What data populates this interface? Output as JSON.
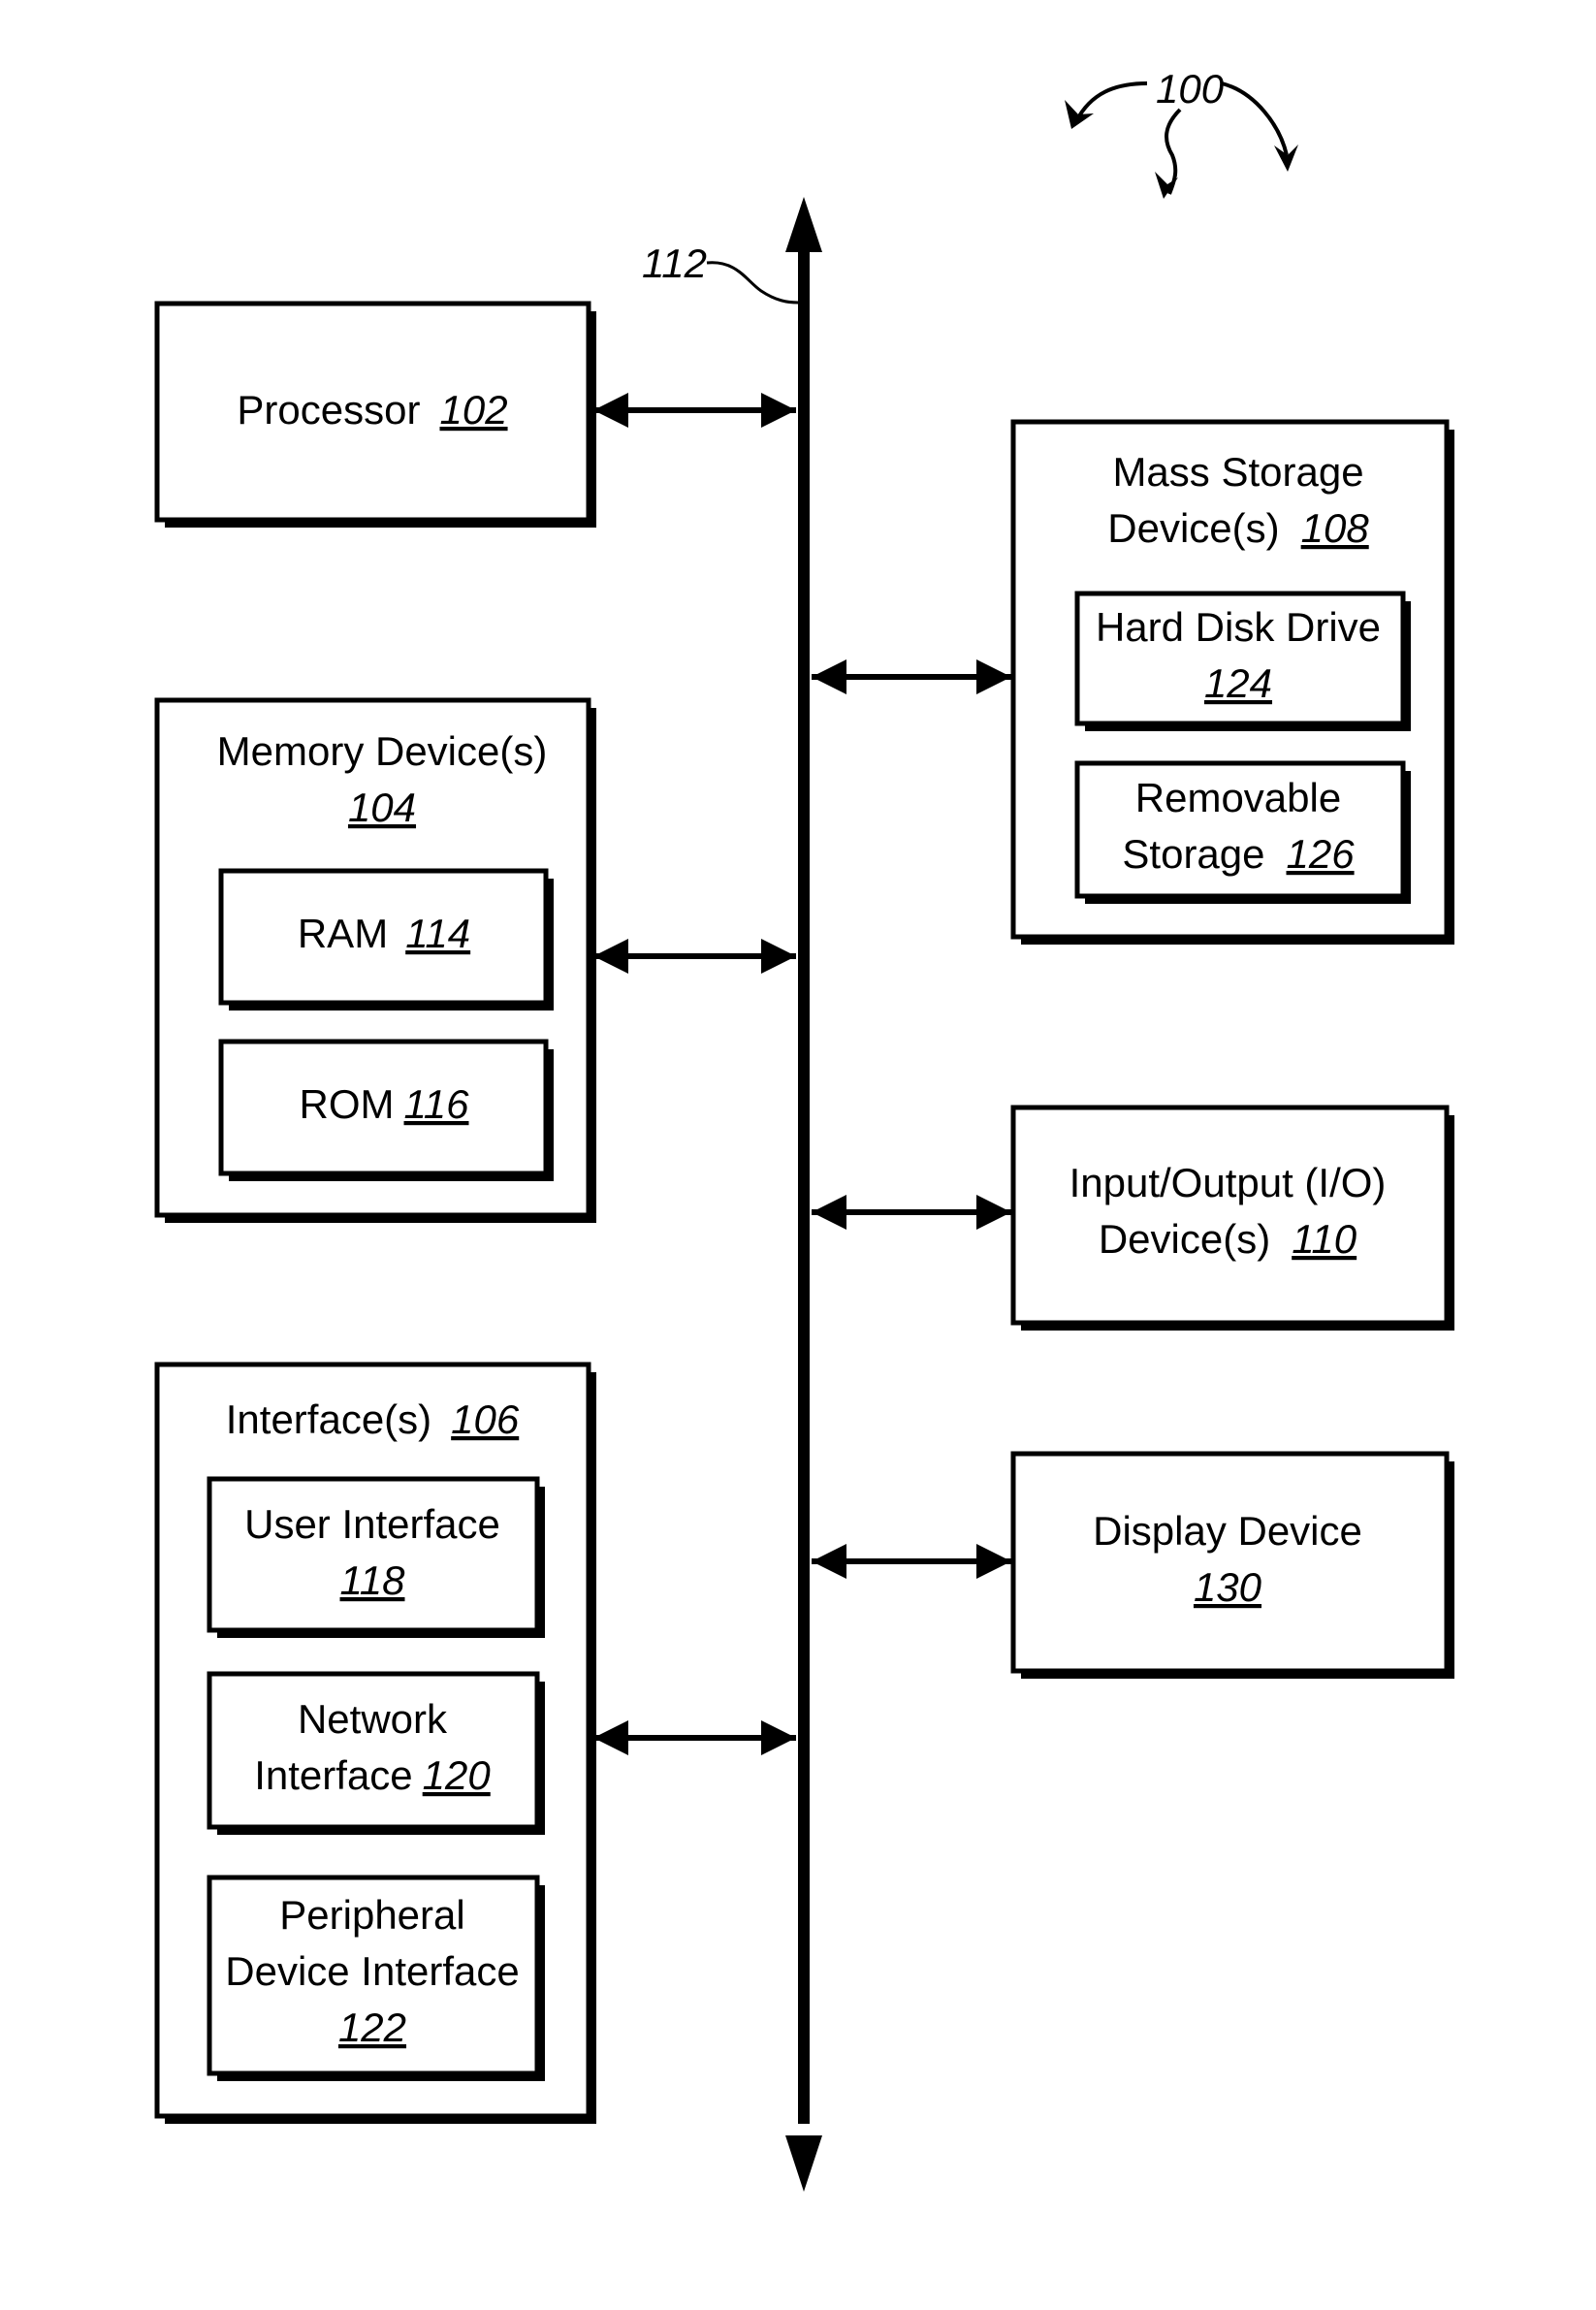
{
  "figure": {
    "reference": "100",
    "bus_reference": "112"
  },
  "blocks": {
    "processor": {
      "label": "Processor",
      "ref": "102"
    },
    "memory": {
      "label": "Memory Device(s)",
      "ref": "104",
      "children": {
        "ram": {
          "label": "RAM",
          "ref": "114"
        },
        "rom": {
          "label": "ROM",
          "ref": "116"
        }
      }
    },
    "interfaces": {
      "label": "Interface(s)",
      "ref": "106",
      "children": {
        "user_interface": {
          "label": "User Interface",
          "ref": "118"
        },
        "network_interface": {
          "label_line1": "Network",
          "label_line2": "Interface",
          "ref": "120"
        },
        "peripheral_interface": {
          "label_line1": "Peripheral",
          "label_line2": "Device Interface",
          "ref": "122"
        }
      }
    },
    "mass_storage": {
      "label_line1": "Mass Storage",
      "label_line2": "Device(s)",
      "ref": "108",
      "children": {
        "hard_disk": {
          "label": "Hard Disk Drive",
          "ref": "124"
        },
        "removable": {
          "label_line1": "Removable",
          "label_line2": "Storage",
          "ref": "126"
        }
      }
    },
    "io_devices": {
      "label_line1": "Input/Output (I/O)",
      "label_line2": "Device(s)",
      "ref": "110"
    },
    "display": {
      "label": "Display Device",
      "ref": "130"
    }
  },
  "connections": [
    {
      "from": "processor",
      "to": "bus",
      "type": "bidirectional"
    },
    {
      "from": "memory",
      "to": "bus",
      "type": "bidirectional"
    },
    {
      "from": "interfaces",
      "to": "bus",
      "type": "bidirectional"
    },
    {
      "from": "mass_storage",
      "to": "bus",
      "type": "bidirectional"
    },
    {
      "from": "io_devices",
      "to": "bus",
      "type": "bidirectional"
    },
    {
      "from": "display",
      "to": "bus",
      "type": "bidirectional"
    }
  ]
}
